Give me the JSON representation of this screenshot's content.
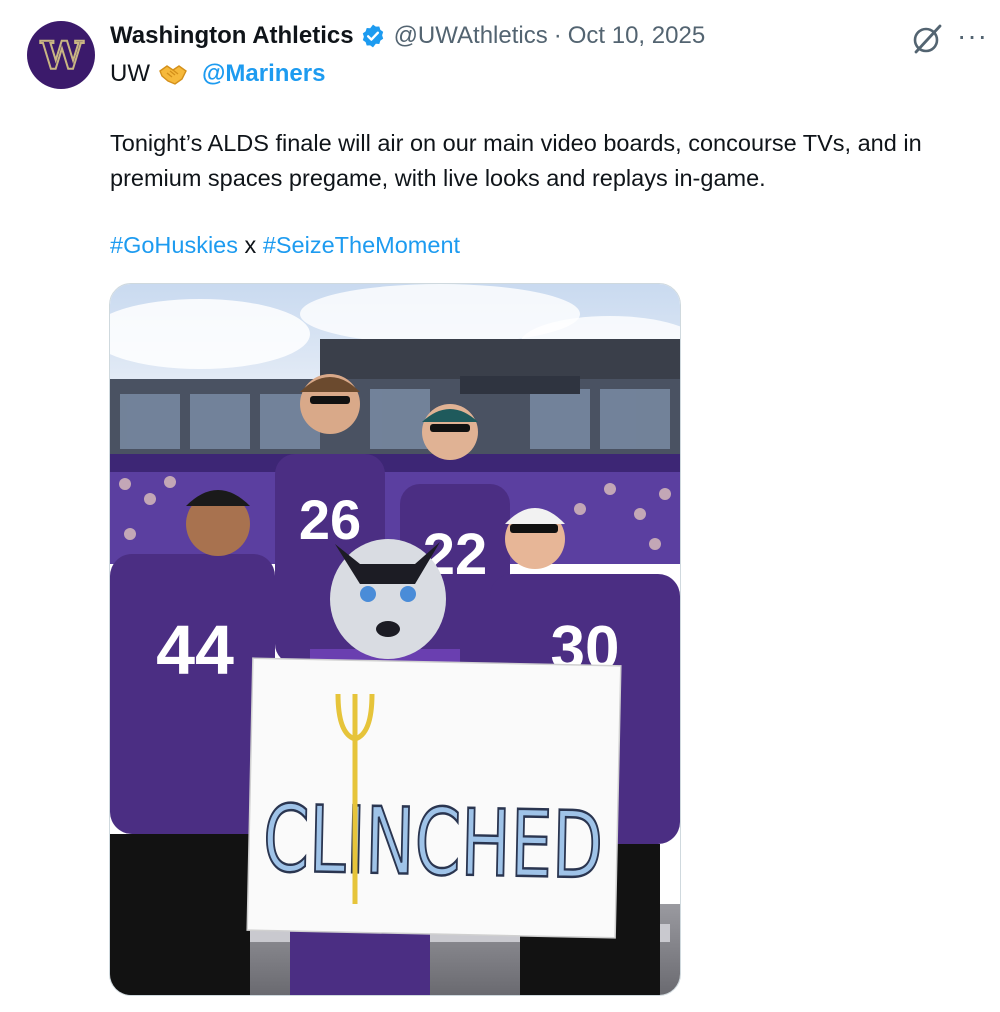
{
  "author": {
    "name": "Washington Athletics",
    "handle": "@UWAthletics",
    "separator": "·",
    "date": "Oct 10, 2025",
    "avatar_letter": "W",
    "verified": true
  },
  "subline": {
    "prefix": "UW",
    "emoji": "handshake-icon",
    "mention": "@Mariners"
  },
  "tweet": {
    "text": "Tonight’s ALDS finale will air on our main video boards, concourse TVs, and in premium spaces pregame, with live looks and replays in-game.",
    "hashtag1": "#GoHuskies",
    "joiner": " x ",
    "hashtag2": "#SeizeTheMoment"
  },
  "image": {
    "jersey_numbers": [
      "26",
      "22",
      "44",
      "30"
    ],
    "sign_text": "CLINCHED"
  },
  "colors": {
    "link": "#1d9bf0",
    "secondary_text": "#536471",
    "husky_purple": "#4b2e83",
    "husky_gold": "#b7a57a"
  }
}
